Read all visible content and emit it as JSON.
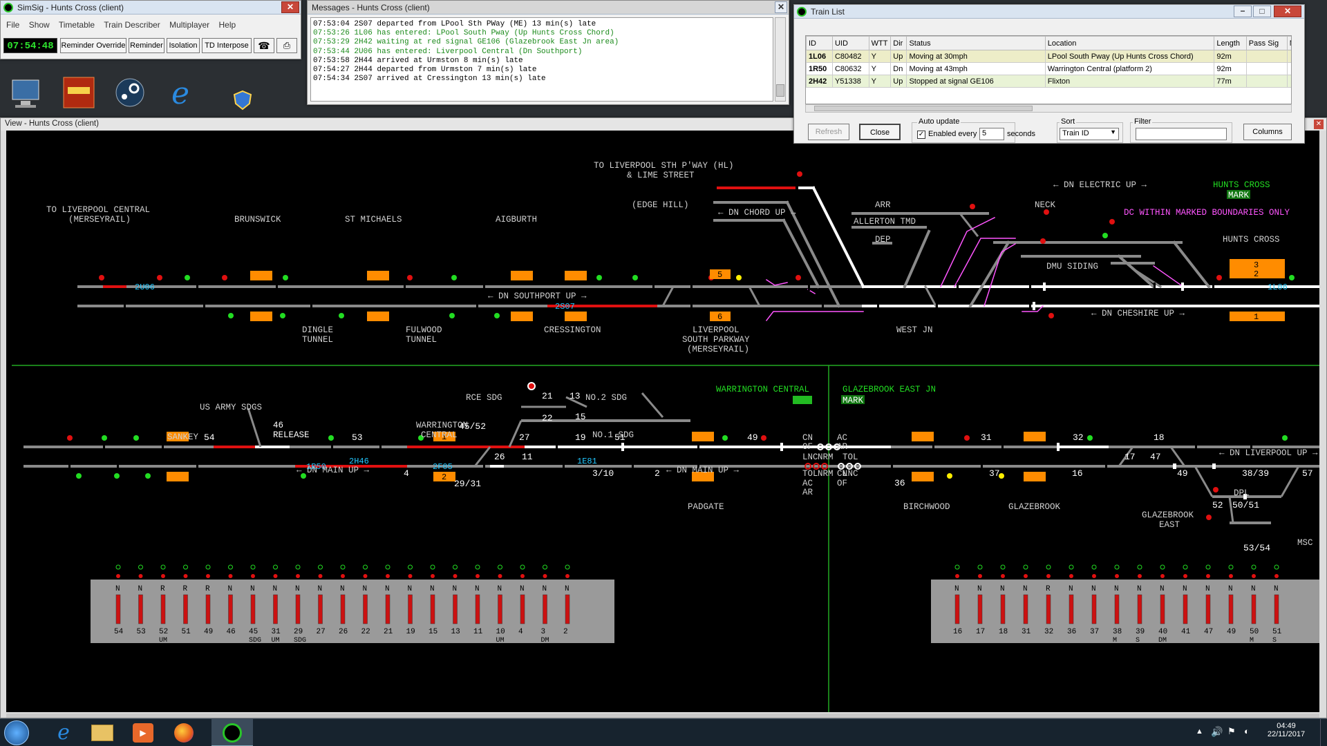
{
  "main_window": {
    "title": "SimSig - Hunts Cross (client)",
    "menu": [
      "File",
      "Show",
      "Timetable",
      "Train Describer",
      "Multiplayer",
      "Help"
    ],
    "clock": "07:54:48",
    "buttons": [
      "Reminder Override",
      "Reminder",
      "Isolation",
      "TD Interpose"
    ]
  },
  "messages_window": {
    "title": "Messages - Hunts Cross (client)",
    "lines": [
      {
        "text": "07:53:04 2S07 departed from LPool Sth PWay (ME) 13 min(s) late",
        "color": "#000000"
      },
      {
        "text": "07:53:26 1L06 has entered: LPool South Pway (Up Hunts Cross Chord)",
        "color": "#1a8a1a"
      },
      {
        "text": "07:53:29 2H42 waiting at red signal GE106 (Glazebrook East Jn area)",
        "color": "#1a8a1a"
      },
      {
        "text": "07:53:44 2U06 has entered: Liverpool Central (Dn Southport)",
        "color": "#1a8a1a"
      },
      {
        "text": "07:53:58 2H44 arrived at Urmston 8 min(s) late",
        "color": "#000000"
      },
      {
        "text": "07:54:27 2H44 departed from Urmston 7 min(s) late",
        "color": "#000000"
      },
      {
        "text": "07:54:34 2S07 arrived at Cressington 13 min(s) late",
        "color": "#000000"
      }
    ]
  },
  "train_list": {
    "title": "Train List",
    "columns": [
      "ID",
      "UID",
      "WTT",
      "Dir",
      "Status",
      "Location",
      "Length",
      "Pass Sig",
      "No"
    ],
    "rows": [
      [
        "1L06",
        "C80482",
        "Y",
        "Up",
        "Moving at 30mph",
        "LPool South Pway (Up Hunts Cross Chord)",
        "92m",
        "",
        ""
      ],
      [
        "1R50",
        "C80632",
        "Y",
        "Dn",
        "Moving at 43mph",
        "Warrington Central (platform 2)",
        "92m",
        "",
        ""
      ],
      [
        "2H42",
        "Y51338",
        "Y",
        "Up",
        "Stopped at signal GE106",
        "Flixton",
        "77m",
        "",
        ""
      ]
    ],
    "refresh_label": "Refresh",
    "close_label": "Close",
    "auto_update_label": "Auto update",
    "enabled_every_label": "Enabled every",
    "interval_value": "5",
    "seconds_label": "seconds",
    "sort_label": "Sort",
    "sort_value": "Train ID",
    "filter_label": "Filter",
    "filter_value": "",
    "columns_label": "Columns"
  },
  "view_window": {
    "title": "View - Hunts Cross (client)"
  },
  "diagram": {
    "north_labels": [
      "TO LIVERPOOL STH P'WAY (HL)",
      "& LIME STREET",
      "(EDGE HILL)",
      "TO LIVERPOOL CENTRAL",
      "(MERSEYRAIL)",
      "BRUNSWICK",
      "ST MICHAELS",
      "AIGBURTH",
      "DINGLE",
      "TUNNEL",
      "FULWOOD",
      "TUNNEL",
      "CRESSINGTON",
      "LIVERPOOL",
      "SOUTH PARKWAY",
      "(MERSEYRAIL)",
      "WEST JN",
      "ARR",
      "NECK",
      "ALLERTON TMD",
      "DEP",
      "DMU SIDING",
      "HUNTS CROSS"
    ],
    "north_line_names": [
      "← DN CHORD UP →",
      "← DN SOUTHPORT UP →",
      "← DN CHESHIRE UP →",
      "← DN ELECTRIC UP →"
    ],
    "north_notice": "DC WITHIN MARKED BOUNDARIES ONLY",
    "hunts_cross_flag": {
      "title": "HUNTS CROSS",
      "badge": "MARK"
    },
    "south_labels": [
      "US ARMY SDGS",
      "SANKEY",
      "46",
      "RELEASE",
      "RCE SDG",
      "NO.2 SDG",
      "NO.1 SDG",
      "WARRINGTON",
      "CENTRAL",
      "PADGATE",
      "BIRCHWOOD",
      "GLAZEBROOK",
      "GLAZEBROOK",
      "EAST",
      "MSC",
      "DPL"
    ],
    "south_line_names": [
      "← DN MAIN UP →",
      "← DN MAIN UP →",
      "← DN MAIN UP →",
      "← DN LIVERPOOL UP →"
    ],
    "warrington_flag": {
      "title": "WARRINGTON CENTRAL"
    },
    "glazebrook_flag": {
      "title": "GLAZEBROOK EAST JN",
      "badge": "MARK"
    },
    "berths": [
      {
        "id": "2U06",
        "color": "#22c8ff"
      },
      {
        "id": "2S07",
        "color": "#22c8ff"
      },
      {
        "id": "1L06",
        "color": "#22c8ff"
      },
      {
        "id": "2H46",
        "color": "#22c8ff"
      },
      {
        "id": "1E81",
        "color": "#22c8ff"
      },
      {
        "id": "1R50",
        "color": "#22c8ff"
      },
      {
        "id": "2F05",
        "color": "#22c8ff"
      }
    ],
    "signal_numbers": [
      "54",
      "53",
      "45/52",
      "27",
      "26",
      "11",
      "21",
      "22",
      "13",
      "15",
      "19",
      "51",
      "49",
      "4",
      "2",
      "29/31",
      "3/10",
      "31",
      "32",
      "18",
      "17",
      "47",
      "49",
      "57",
      "38/39",
      "37",
      "16",
      "36",
      "52",
      "50/51",
      "53/54"
    ],
    "platform_numbers": [
      "5",
      "6",
      "3",
      "2",
      "1",
      "1",
      "2"
    ],
    "crossing_labels": [
      "CN",
      "OF",
      "AC",
      "AR",
      "LNC",
      "NRM",
      "TOL",
      "TOL",
      "NRM",
      "LNC",
      "AC",
      "AR",
      "CN",
      "OF"
    ],
    "panel_left": [
      {
        "mark": "N",
        "num": "54",
        "sub": ""
      },
      {
        "mark": "N",
        "num": "53",
        "sub": ""
      },
      {
        "mark": "R",
        "num": "52",
        "sub": "UM"
      },
      {
        "mark": "R",
        "num": "51",
        "sub": ""
      },
      {
        "mark": "R",
        "num": "49",
        "sub": ""
      },
      {
        "mark": "N",
        "num": "46",
        "sub": ""
      },
      {
        "mark": "N",
        "num": "45",
        "sub": "SDG"
      },
      {
        "mark": "N",
        "num": "31",
        "sub": "UM"
      },
      {
        "mark": "N",
        "num": "29",
        "sub": "SDG"
      },
      {
        "mark": "N",
        "num": "27",
        "sub": ""
      },
      {
        "mark": "N",
        "num": "26",
        "sub": ""
      },
      {
        "mark": "N",
        "num": "22",
        "sub": ""
      },
      {
        "mark": "N",
        "num": "21",
        "sub": ""
      },
      {
        "mark": "N",
        "num": "19",
        "sub": ""
      },
      {
        "mark": "N",
        "num": "15",
        "sub": ""
      },
      {
        "mark": "N",
        "num": "13",
        "sub": ""
      },
      {
        "mark": "N",
        "num": "11",
        "sub": ""
      },
      {
        "mark": "N",
        "num": "10",
        "sub": "UM"
      },
      {
        "mark": "N",
        "num": "4",
        "sub": ""
      },
      {
        "mark": "N",
        "num": "3",
        "sub": "DM"
      },
      {
        "mark": "N",
        "num": "2",
        "sub": ""
      }
    ],
    "panel_right": [
      {
        "mark": "N",
        "num": "16",
        "sub": ""
      },
      {
        "mark": "N",
        "num": "17",
        "sub": ""
      },
      {
        "mark": "N",
        "num": "18",
        "sub": ""
      },
      {
        "mark": "N",
        "num": "31",
        "sub": ""
      },
      {
        "mark": "R",
        "num": "32",
        "sub": ""
      },
      {
        "mark": "N",
        "num": "36",
        "sub": ""
      },
      {
        "mark": "N",
        "num": "37",
        "sub": ""
      },
      {
        "mark": "N",
        "num": "38",
        "sub": "M"
      },
      {
        "mark": "N",
        "num": "39",
        "sub": "S"
      },
      {
        "mark": "N",
        "num": "40",
        "sub": "DM"
      },
      {
        "mark": "N",
        "num": "41",
        "sub": ""
      },
      {
        "mark": "N",
        "num": "47",
        "sub": ""
      },
      {
        "mark": "N",
        "num": "49",
        "sub": ""
      },
      {
        "mark": "N",
        "num": "50",
        "sub": "M"
      },
      {
        "mark": "N",
        "num": "51",
        "sub": "S"
      }
    ]
  },
  "taskbar": {
    "time": "04:49",
    "date": "22/11/2017"
  },
  "colors": {
    "track_white": "#ffffff",
    "track_grey": "#8a8a8a",
    "track_red": "#e01010",
    "berth": "#22c8ff",
    "platform": "#ff8c00",
    "label_green": "#22dd22",
    "label_magenta": "#ff55ff"
  }
}
